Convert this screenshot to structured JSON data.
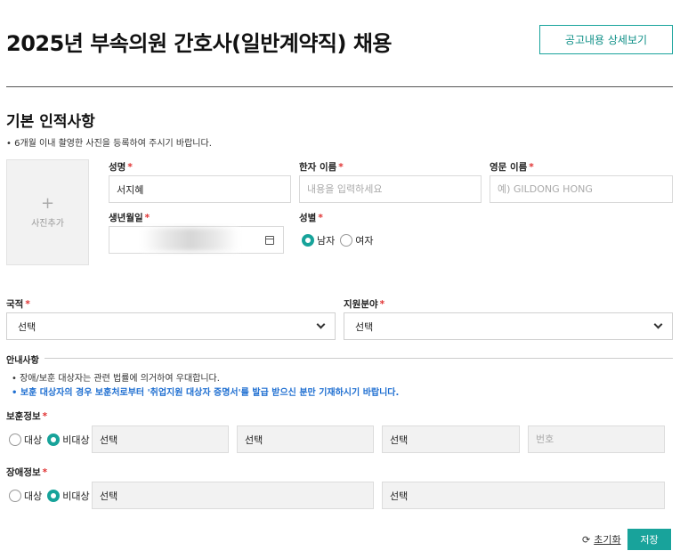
{
  "header": {
    "title": "2025년 부속의원 간호사(일반계약직) 채용",
    "notice_button": "공고내용 상세보기"
  },
  "basic": {
    "section_title": "기본 인적사항",
    "note": "• 6개월 이내 촬영한 사진을 등록하여 주시기 바랍니다.",
    "photo": {
      "plus": "+",
      "label": "사진추가"
    },
    "required_mark": "*",
    "name": {
      "label": "성명",
      "value": "서지혜"
    },
    "hanja_name": {
      "label": "한자 이름",
      "placeholder": "내용을 입력하세요"
    },
    "english_name": {
      "label": "영문 이름",
      "placeholder": "예) GILDONG HONG"
    },
    "birth": {
      "label": "생년월일",
      "icon": "calendar-icon"
    },
    "gender": {
      "label": "성별",
      "options": [
        "남자",
        "여자"
      ],
      "selected": "남자"
    }
  },
  "nationality": {
    "label": "국적",
    "value": "선택"
  },
  "field": {
    "label": "지원분야",
    "value": "선택"
  },
  "guide": {
    "title": "안내사항",
    "line1": "• 장애/보훈 대상자는 관련 법률에 의거하여 우대합니다.",
    "line2": "• 보훈 대상자의 경우 보훈처로부터 '취업지원 대상자 증명서'를 발급 받으신 분만 기재하시기 바랍니다."
  },
  "veteran": {
    "label": "보훈정보",
    "options": [
      "대상",
      "비대상"
    ],
    "selected": "비대상",
    "select1": "선택",
    "select2": "선택",
    "select3": "선택",
    "number_placeholder": "번호"
  },
  "disability": {
    "label": "장애정보",
    "options": [
      "대상",
      "비대상"
    ],
    "selected": "비대상",
    "select1": "선택",
    "select2": "선택"
  },
  "actions": {
    "reset": "초기화",
    "save": "저장",
    "reset_icon": "refresh-icon"
  },
  "colors": {
    "accent": "#18a39b",
    "required": "#e03131",
    "notice_blue": "#1f6fd1"
  }
}
